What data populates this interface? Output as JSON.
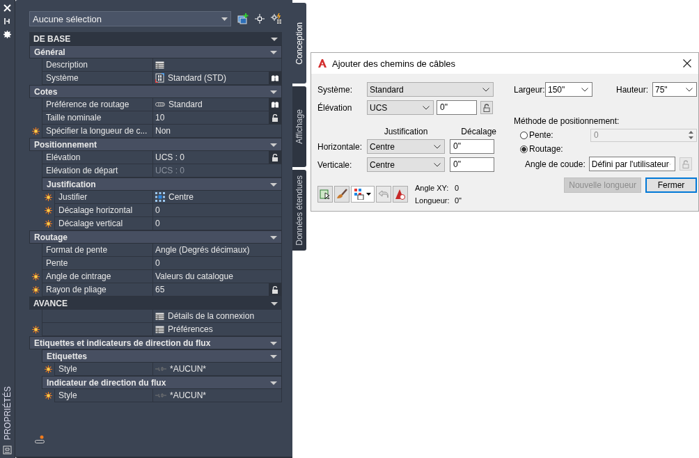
{
  "palette": {
    "title": "PROPRIÉTÉS",
    "selection": "Aucune sélection",
    "tabs": [
      {
        "label": "Conception",
        "selected": true
      },
      {
        "label": "Affichage",
        "selected": false
      },
      {
        "label": "Données étendues",
        "selected": false
      }
    ],
    "sections": [
      {
        "kind": "category",
        "title": "DE BASE",
        "expanded": true,
        "children": [
          {
            "kind": "group",
            "title": "Général",
            "expanded": true,
            "children": [
              {
                "kind": "table",
                "label": "Description",
                "flagged": false,
                "disabled": false
              },
              {
                "kind": "system",
                "label": "Système",
                "value": "Standard (STD)",
                "flagged": false,
                "disabled": false
              }
            ]
          },
          {
            "kind": "group",
            "title": "Cotes",
            "expanded": true,
            "children": [
              {
                "kind": "routing",
                "label": "Préférence de routage",
                "value": "Standard",
                "flagged": false,
                "disabled": false
              },
              {
                "kind": "locked",
                "label": "Taille nominale",
                "value": "10",
                "flagged": false,
                "disabled": false
              },
              {
                "kind": "text",
                "label": "Spécifier la longueur de c...",
                "value": "Non",
                "flagged": true,
                "disabled": false
              }
            ]
          },
          {
            "kind": "group",
            "title": "Positionnement",
            "expanded": true,
            "children": [
              {
                "kind": "locked",
                "label": "Elévation",
                "value": "UCS : 0",
                "flagged": false,
                "disabled": false
              },
              {
                "kind": "text",
                "label": "Elévation de départ",
                "value": "UCS : 0",
                "flagged": false,
                "disabled": true
              },
              {
                "kind": "group",
                "title": "Justification",
                "expanded": true,
                "children": [
                  {
                    "kind": "grid",
                    "label": "Justifier",
                    "value": "Centre",
                    "flagged": true,
                    "disabled": false
                  },
                  {
                    "kind": "text",
                    "label": "Décalage horizontal",
                    "value": "0",
                    "flagged": true,
                    "disabled": false
                  },
                  {
                    "kind": "text",
                    "label": "Décalage vertical",
                    "value": "0",
                    "flagged": true,
                    "disabled": false
                  }
                ]
              }
            ]
          },
          {
            "kind": "group",
            "title": "Routage",
            "expanded": true,
            "children": [
              {
                "kind": "text",
                "label": "Format de pente",
                "value": "Angle (Degrés décimaux)",
                "flagged": false,
                "disabled": false
              },
              {
                "kind": "text",
                "label": "Pente",
                "value": "0",
                "flagged": false,
                "disabled": false
              },
              {
                "kind": "text",
                "label": "Angle de cintrage",
                "value": "Valeurs du catalogue",
                "flagged": true,
                "disabled": false
              },
              {
                "kind": "locked",
                "label": "Rayon de pliage",
                "value": "65",
                "flagged": true,
                "disabled": false
              }
            ]
          }
        ]
      },
      {
        "kind": "category",
        "title": "AVANCE",
        "expanded": true,
        "children": [
          {
            "kind": "table",
            "value": "Détails de la connexion",
            "flagged": false,
            "disabled": false
          },
          {
            "kind": "table",
            "value": "Préférences",
            "flagged": true,
            "disabled": false
          },
          {
            "kind": "group",
            "title": "Etiquettes et indicateurs de direction du flux",
            "expanded": true,
            "children": [
              {
                "kind": "group",
                "title": "Etiquettes",
                "expanded": true,
                "children": [
                  {
                    "kind": "tag",
                    "label": "Style",
                    "value": "*AUCUN*",
                    "flagged": true,
                    "disabled": false
                  }
                ]
              },
              {
                "kind": "group",
                "title": "Indicateur de direction du flux",
                "expanded": true,
                "children": [
                  {
                    "kind": "tag",
                    "label": "Style",
                    "value": "*AUCUN*",
                    "flagged": true,
                    "disabled": false
                  }
                ]
              }
            ]
          }
        ]
      }
    ]
  },
  "dialog": {
    "title": "Ajouter des chemins de câbles",
    "system": {
      "label": "Système:",
      "value": "Standard"
    },
    "width": {
      "label": "Largeur:",
      "value": "150\""
    },
    "height": {
      "label": "Hauteur:",
      "value": "75\""
    },
    "elevation": {
      "label": "Élévation",
      "mode": "UCS",
      "value": "0\""
    },
    "justification": {
      "heading": "Justification",
      "offset_heading": "Décalage",
      "rows": [
        {
          "label": "Horizontale:",
          "value": "Centre",
          "offset": "0\""
        },
        {
          "label": "Verticale:",
          "value": "Centre",
          "offset": "0\""
        }
      ]
    },
    "placement": {
      "heading": "Méthode de positionnement:",
      "options": [
        {
          "label": "Pente:",
          "selected": false
        },
        {
          "label": "Routage:",
          "selected": true
        }
      ],
      "slope": {
        "value": "0",
        "disabled": true
      },
      "bend_angle": {
        "label": "Angle de coude:",
        "value": "Défini par l'utilisateur"
      }
    },
    "undo": {
      "disabled": true
    },
    "readouts": [
      {
        "label": "Angle XY:",
        "value": "0"
      },
      {
        "label": "Longueur:",
        "value": "0\""
      }
    ],
    "buttons": [
      {
        "label": "Nouvelle longueur",
        "disabled": true,
        "default": false
      },
      {
        "label": "Fermer",
        "disabled": false,
        "default": true
      }
    ]
  }
}
